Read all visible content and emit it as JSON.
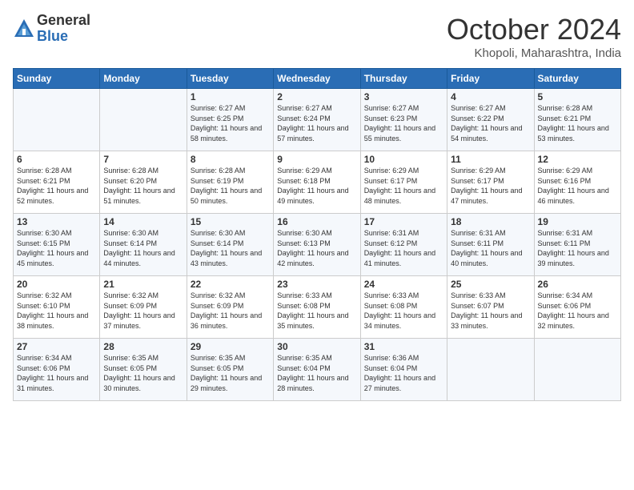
{
  "header": {
    "logo_general": "General",
    "logo_blue": "Blue",
    "month_title": "October 2024",
    "location": "Khopoli, Maharashtra, India"
  },
  "weekdays": [
    "Sunday",
    "Monday",
    "Tuesday",
    "Wednesday",
    "Thursday",
    "Friday",
    "Saturday"
  ],
  "weeks": [
    [
      {
        "day": "",
        "empty": true
      },
      {
        "day": "",
        "empty": true
      },
      {
        "day": "1",
        "sunrise": "6:27 AM",
        "sunset": "6:25 PM",
        "daylight": "11 hours and 58 minutes."
      },
      {
        "day": "2",
        "sunrise": "6:27 AM",
        "sunset": "6:24 PM",
        "daylight": "11 hours and 57 minutes."
      },
      {
        "day": "3",
        "sunrise": "6:27 AM",
        "sunset": "6:23 PM",
        "daylight": "11 hours and 55 minutes."
      },
      {
        "day": "4",
        "sunrise": "6:27 AM",
        "sunset": "6:22 PM",
        "daylight": "11 hours and 54 minutes."
      },
      {
        "day": "5",
        "sunrise": "6:28 AM",
        "sunset": "6:21 PM",
        "daylight": "11 hours and 53 minutes."
      }
    ],
    [
      {
        "day": "6",
        "sunrise": "6:28 AM",
        "sunset": "6:21 PM",
        "daylight": "11 hours and 52 minutes."
      },
      {
        "day": "7",
        "sunrise": "6:28 AM",
        "sunset": "6:20 PM",
        "daylight": "11 hours and 51 minutes."
      },
      {
        "day": "8",
        "sunrise": "6:28 AM",
        "sunset": "6:19 PM",
        "daylight": "11 hours and 50 minutes."
      },
      {
        "day": "9",
        "sunrise": "6:29 AM",
        "sunset": "6:18 PM",
        "daylight": "11 hours and 49 minutes."
      },
      {
        "day": "10",
        "sunrise": "6:29 AM",
        "sunset": "6:17 PM",
        "daylight": "11 hours and 48 minutes."
      },
      {
        "day": "11",
        "sunrise": "6:29 AM",
        "sunset": "6:17 PM",
        "daylight": "11 hours and 47 minutes."
      },
      {
        "day": "12",
        "sunrise": "6:29 AM",
        "sunset": "6:16 PM",
        "daylight": "11 hours and 46 minutes."
      }
    ],
    [
      {
        "day": "13",
        "sunrise": "6:30 AM",
        "sunset": "6:15 PM",
        "daylight": "11 hours and 45 minutes."
      },
      {
        "day": "14",
        "sunrise": "6:30 AM",
        "sunset": "6:14 PM",
        "daylight": "11 hours and 44 minutes."
      },
      {
        "day": "15",
        "sunrise": "6:30 AM",
        "sunset": "6:14 PM",
        "daylight": "11 hours and 43 minutes."
      },
      {
        "day": "16",
        "sunrise": "6:30 AM",
        "sunset": "6:13 PM",
        "daylight": "11 hours and 42 minutes."
      },
      {
        "day": "17",
        "sunrise": "6:31 AM",
        "sunset": "6:12 PM",
        "daylight": "11 hours and 41 minutes."
      },
      {
        "day": "18",
        "sunrise": "6:31 AM",
        "sunset": "6:11 PM",
        "daylight": "11 hours and 40 minutes."
      },
      {
        "day": "19",
        "sunrise": "6:31 AM",
        "sunset": "6:11 PM",
        "daylight": "11 hours and 39 minutes."
      }
    ],
    [
      {
        "day": "20",
        "sunrise": "6:32 AM",
        "sunset": "6:10 PM",
        "daylight": "11 hours and 38 minutes."
      },
      {
        "day": "21",
        "sunrise": "6:32 AM",
        "sunset": "6:09 PM",
        "daylight": "11 hours and 37 minutes."
      },
      {
        "day": "22",
        "sunrise": "6:32 AM",
        "sunset": "6:09 PM",
        "daylight": "11 hours and 36 minutes."
      },
      {
        "day": "23",
        "sunrise": "6:33 AM",
        "sunset": "6:08 PM",
        "daylight": "11 hours and 35 minutes."
      },
      {
        "day": "24",
        "sunrise": "6:33 AM",
        "sunset": "6:08 PM",
        "daylight": "11 hours and 34 minutes."
      },
      {
        "day": "25",
        "sunrise": "6:33 AM",
        "sunset": "6:07 PM",
        "daylight": "11 hours and 33 minutes."
      },
      {
        "day": "26",
        "sunrise": "6:34 AM",
        "sunset": "6:06 PM",
        "daylight": "11 hours and 32 minutes."
      }
    ],
    [
      {
        "day": "27",
        "sunrise": "6:34 AM",
        "sunset": "6:06 PM",
        "daylight": "11 hours and 31 minutes."
      },
      {
        "day": "28",
        "sunrise": "6:35 AM",
        "sunset": "6:05 PM",
        "daylight": "11 hours and 30 minutes."
      },
      {
        "day": "29",
        "sunrise": "6:35 AM",
        "sunset": "6:05 PM",
        "daylight": "11 hours and 29 minutes."
      },
      {
        "day": "30",
        "sunrise": "6:35 AM",
        "sunset": "6:04 PM",
        "daylight": "11 hours and 28 minutes."
      },
      {
        "day": "31",
        "sunrise": "6:36 AM",
        "sunset": "6:04 PM",
        "daylight": "11 hours and 27 minutes."
      },
      {
        "day": "",
        "empty": true
      },
      {
        "day": "",
        "empty": true
      }
    ]
  ]
}
